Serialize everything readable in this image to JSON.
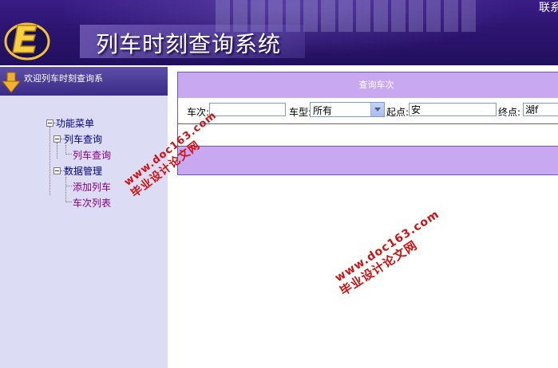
{
  "header": {
    "title": "列车时刻查询系统",
    "contact_label": "联系"
  },
  "sidebar": {
    "welcome": "欢迎列车时刻查询系",
    "menu_root": "功能菜单",
    "groups": [
      {
        "label": "列车查询",
        "items": [
          "列车查询"
        ]
      },
      {
        "label": "数据管理",
        "items": [
          "添加列车",
          "车次列表"
        ]
      }
    ]
  },
  "search": {
    "header": "查询车次",
    "train_no_label": "车次:",
    "train_no_value": "",
    "train_type_label": "车型:",
    "train_type_value": "所有",
    "from_label": "起点:",
    "from_value": "安",
    "to_label": "终点:",
    "to_value": "湖f"
  },
  "watermark": {
    "url": "www.doc163.com",
    "text": "毕业设计论文网"
  },
  "colors": {
    "header_bg": "#2d1470",
    "sidebar_bg": "#dcdcf4",
    "panel_header_bg": "#c8a8f0",
    "watermark": "#d21010"
  }
}
